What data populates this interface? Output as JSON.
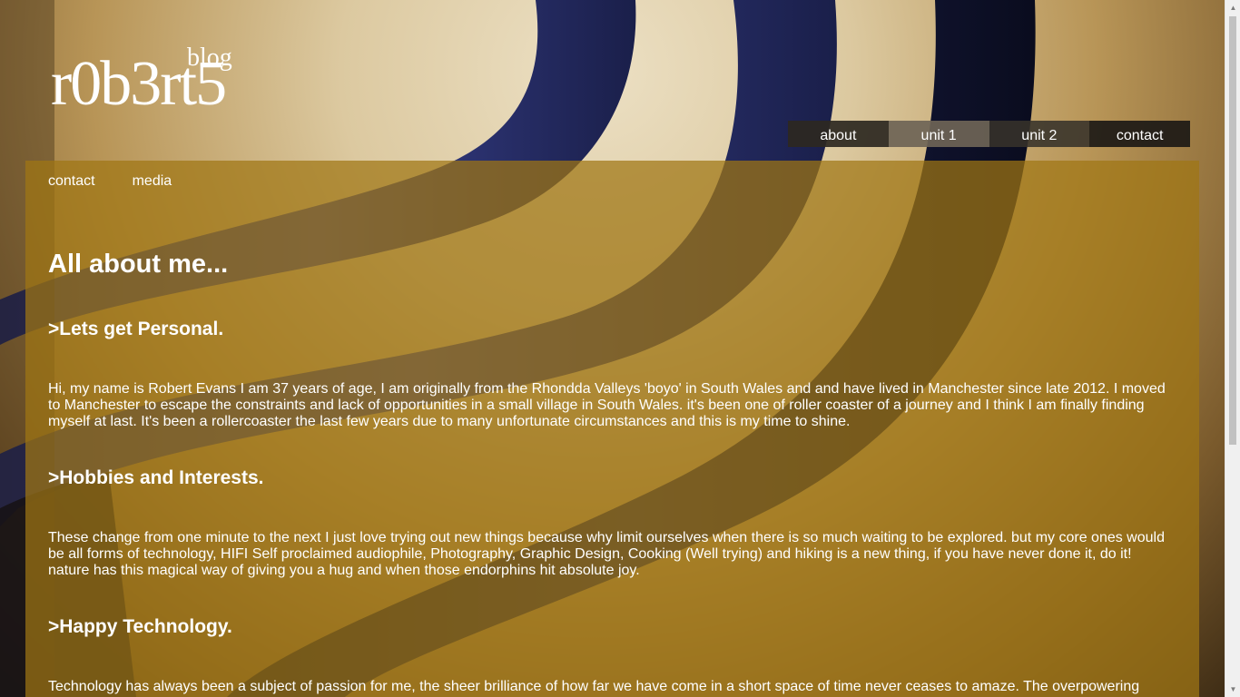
{
  "logo": {
    "main": "r0b3rt5",
    "sub": "blog"
  },
  "top_nav": [
    {
      "label": "about"
    },
    {
      "label": "unit 1"
    },
    {
      "label": "unit 2"
    },
    {
      "label": "contact"
    }
  ],
  "sub_nav": [
    {
      "label": "contact"
    },
    {
      "label": "media"
    }
  ],
  "main": {
    "title": "All about me...",
    "sections": [
      {
        "heading": ">Lets get Personal.",
        "text": "Hi, my name is Robert Evans I am 37 years of age, I am originally from the Rhondda Valleys 'boyo' in South Wales and and have lived in Manchester since late 2012. I moved to Manchester to escape the constraints and lack of opportunities in a small village in South Wales. it's been one of roller coaster of a journey and I think I am finally finding myself at last. It's been a rollercoaster the last few years due to many unfortunate circumstances and this is my time to shine."
      },
      {
        "heading": ">Hobbies and Interests.",
        "text": "These change from one minute to the next I just love trying out new things because why limit ourselves when there is so much waiting to be explored. but my core ones would be all forms of technology, HIFI Self proclaimed audiophile, Photography, Graphic Design, Cooking (Well trying) and hiking is a new thing, if you have never done it, do it! nature has this magical way of giving you a hug and when those endorphins hit absolute joy."
      },
      {
        "heading": ">Happy Technology.",
        "text": "Technology has always been a subject of passion for me, the sheer brilliance of how far we have come in a short space of time never ceases to amaze. The overpowering"
      }
    ]
  },
  "colors": {
    "panel": "#a07614",
    "stripe_blue": "#2a2f6e",
    "stripe_dark": "#0e1230"
  },
  "icons": {
    "scroll_up": "triangle-up",
    "scroll_down": "triangle-down"
  }
}
